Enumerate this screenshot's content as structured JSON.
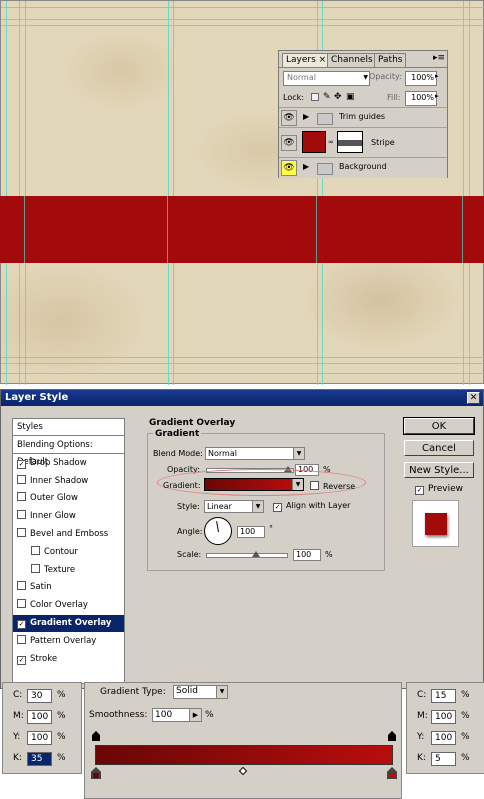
{
  "layers_panel": {
    "tabs": [
      "Layers",
      "Channels",
      "Paths"
    ],
    "blend_mode": "Normal",
    "opacity_label": "Opacity:",
    "opacity_value": "100%",
    "lock_label": "Lock:",
    "fill_label": "Fill:",
    "fill_value": "100%",
    "layers": [
      {
        "name": "Trim guides",
        "type": "group"
      },
      {
        "name": "Stripe",
        "type": "layer"
      },
      {
        "name": "Background",
        "type": "group"
      }
    ]
  },
  "dialog": {
    "title": "Layer Style",
    "styles_header": "Styles",
    "style_items": [
      {
        "label": "Blending Options: Default",
        "checkbox": false,
        "checked": false
      },
      {
        "label": "Drop Shadow",
        "checkbox": true,
        "checked": true
      },
      {
        "label": "Inner Shadow",
        "checkbox": true,
        "checked": false
      },
      {
        "label": "Outer Glow",
        "checkbox": true,
        "checked": false
      },
      {
        "label": "Inner Glow",
        "checkbox": true,
        "checked": false
      },
      {
        "label": "Bevel and Emboss",
        "checkbox": true,
        "checked": false
      },
      {
        "label": "Contour",
        "checkbox": true,
        "checked": false
      },
      {
        "label": "Texture",
        "checkbox": true,
        "checked": false
      },
      {
        "label": "Satin",
        "checkbox": true,
        "checked": false
      },
      {
        "label": "Color Overlay",
        "checkbox": true,
        "checked": false
      },
      {
        "label": "Gradient Overlay",
        "checkbox": true,
        "checked": true
      },
      {
        "label": "Pattern Overlay",
        "checkbox": true,
        "checked": false
      },
      {
        "label": "Stroke",
        "checkbox": true,
        "checked": true
      }
    ],
    "section_title": "Gradient Overlay",
    "group_title": "Gradient",
    "blend_mode_label": "Blend Mode:",
    "blend_mode_value": "Normal",
    "opacity_label": "Opacity:",
    "opacity_value": "100",
    "percent": "%",
    "gradient_label": "Gradient:",
    "reverse_label": "Reverse",
    "style_label": "Style:",
    "style_value": "Linear",
    "align_label": "Align with Layer",
    "angle_label": "Angle:",
    "angle_value": "100",
    "degree": "°",
    "scale_label": "Scale:",
    "scale_value": "100",
    "buttons": {
      "ok": "OK",
      "cancel": "Cancel",
      "new_style": "New Style..."
    },
    "preview_label": "Preview",
    "colors": {
      "stripe": "#a30a0c",
      "gradient_left": "#6a0606",
      "gradient_right": "#b80d0d"
    }
  },
  "left_stop": {
    "rows": [
      {
        "key": "C:",
        "value": "30",
        "unit": "%"
      },
      {
        "key": "M:",
        "value": "100",
        "unit": "%"
      },
      {
        "key": "Y:",
        "value": "100",
        "unit": "%"
      },
      {
        "key": "K:",
        "value": "35",
        "unit": "%"
      }
    ]
  },
  "right_stop": {
    "rows": [
      {
        "key": "C:",
        "value": "15",
        "unit": "%"
      },
      {
        "key": "M:",
        "value": "100",
        "unit": "%"
      },
      {
        "key": "Y:",
        "value": "100",
        "unit": "%"
      },
      {
        "key": "K:",
        "value": "5",
        "unit": "%"
      }
    ]
  },
  "gradient_editor": {
    "type_label": "Gradient Type:",
    "type_value": "Solid",
    "smoothness_label": "Smoothness:",
    "smoothness_value": "100",
    "percent": "%"
  }
}
